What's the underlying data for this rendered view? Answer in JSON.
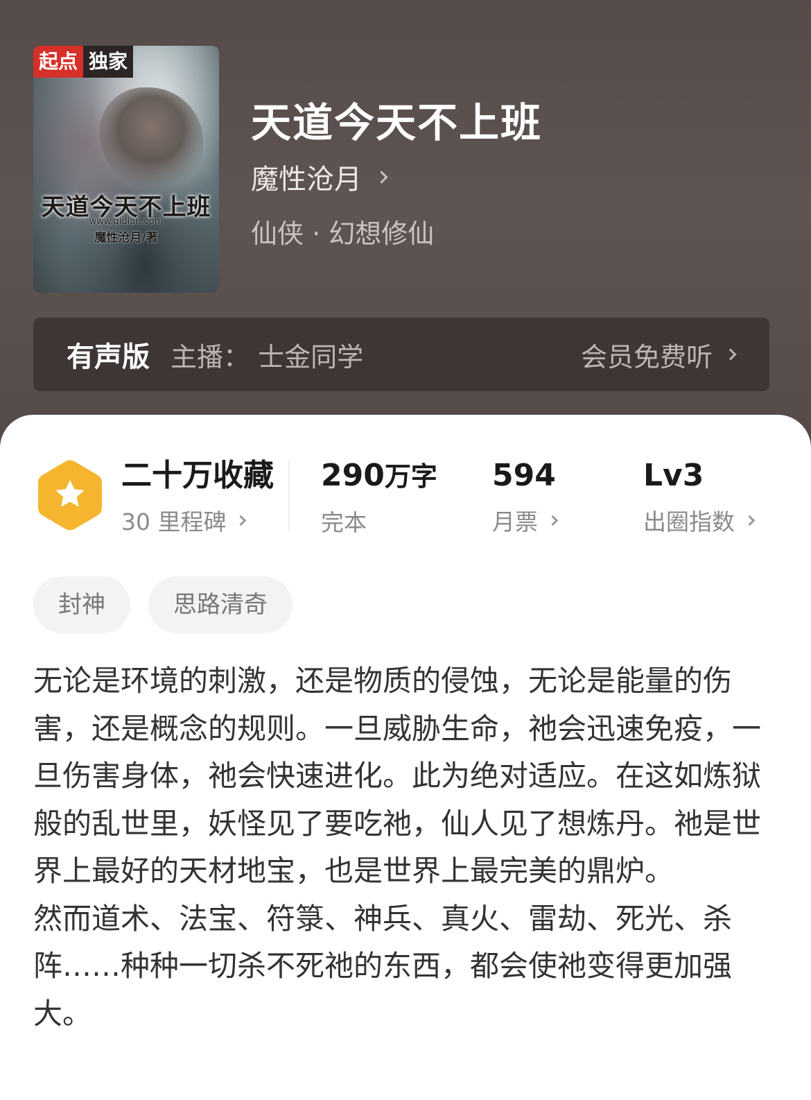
{
  "book": {
    "title": "天道今天不上班",
    "author": "魔性沧月",
    "genre": "仙侠 · 幻想修仙"
  },
  "cover": {
    "badge_left": "起点",
    "badge_right": "独家",
    "title": "天道今天不上班",
    "url": "www.qidian.com",
    "author": "魔性沧月/著"
  },
  "audio": {
    "label": "有声版",
    "host": "主播：  士金同学",
    "action": "会员免费听"
  },
  "stats": {
    "collection": {
      "main": "二十万收藏",
      "sub": "30 里程碑"
    },
    "words": {
      "number": "290",
      "unit": "万字",
      "sub": "完本"
    },
    "monthly": {
      "main": "594",
      "sub": "月票"
    },
    "level": {
      "main": "Lv3",
      "sub": "出圈指数"
    }
  },
  "tags": [
    "封神",
    "思路清奇"
  ],
  "synopsis": {
    "p1": "无论是环境的刺激，还是物质的侵蚀，无论是能量的伤害，还是概念的规则。一旦威胁生命，祂会迅速免疫，一旦伤害身体，祂会快速进化。此为绝对适应。在这如炼狱般的乱世里，妖怪见了要吃祂，仙人见了想炼丹。祂是世界上最好的天材地宝，也是世界上最完美的鼎炉。",
    "p2": "然而道术、法宝、符箓、神兵、真火、雷劫、死光、杀阵……种种一切杀不死祂的东西，都会使祂变得更加强大。"
  },
  "colors": {
    "header_bg": "#5a504e",
    "audio_bar_bg": "#3d3635",
    "badge_red": "#d5302a",
    "hex_badge": "#f6b52f"
  },
  "icons": [
    "chevron-right-icon",
    "star-hexagon-icon"
  ]
}
